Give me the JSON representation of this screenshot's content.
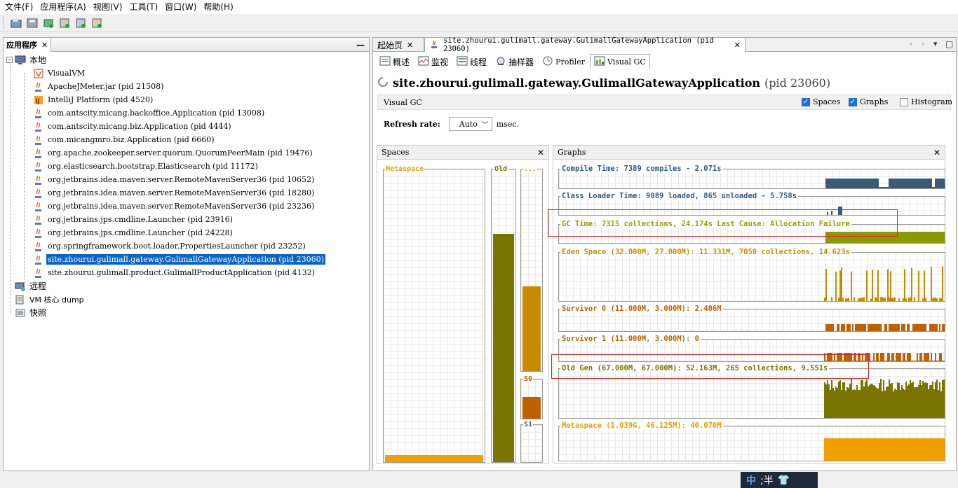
{
  "menu": [
    "文件(F)",
    "应用程序(A)",
    "视图(V)",
    "工具(T)",
    "窗口(W)",
    "帮助(H)"
  ],
  "toolbar": {
    "icons": [
      "open-icon",
      "save-icon",
      "add-jmx-icon",
      "add-core-dump-icon",
      "add-snapshot-icon",
      "add-heap-icon"
    ]
  },
  "left_panel": {
    "tab_label": "应用程序",
    "local": "本地",
    "items": [
      "VisualVM",
      "ApacheJMeter.jar (pid 21508)",
      "IntelliJ Platform (pid 4520)",
      "com.antscity.micang.backoffice.Application (pid 13008)",
      "com.antscity.micang.biz.Application (pid 4444)",
      "com.micangmro.biz.Application (pid 6660)",
      "org.apache.zookeeper.server.quorum.QuorumPeerMain (pid 19476)",
      "org.elasticsearch.bootstrap.Elasticsearch (pid 11172)",
      "org.jetbrains.idea.maven.server.RemoteMavenServer36 (pid 10652)",
      "org.jetbrains.idea.maven.server.RemoteMavenServer36 (pid 18280)",
      "org.jetbrains.idea.maven.server.RemoteMavenServer36 (pid 23236)",
      "org.jetbrains.jps.cmdline.Launcher (pid 23916)",
      "org.jetbrains.jps.cmdline.Launcher (pid 24228)",
      "org.springframework.boot.loader.PropertiesLauncher (pid 23252)",
      "site.zhourui.gulimall.gateway.GulimallGatewayApplication (pid 23060)",
      "site.zhourui.gulimall.product.GulimallProductApplication (pid 4132)"
    ],
    "selected_index": 14,
    "remote": "远程",
    "core_dump": "VM 核心 dump",
    "snapshot": "快照"
  },
  "doc_tabs": {
    "start": "起始页",
    "app": "site.zhourui.gulimall.gateway.GulimallGatewayApplication (pid 23060)"
  },
  "sub_tabs": [
    "概述",
    "监视",
    "线程",
    "抽样器",
    "Profiler",
    "Visual GC"
  ],
  "app_title": {
    "name": "site.zhourui.gulimall.gateway.GulimallGatewayApplication",
    "pid": "(pid 23060)"
  },
  "visual_gc": {
    "label": "Visual GC",
    "spaces_label": "Spaces",
    "graphs_label": "Graphs",
    "histogram_label": "Histogram",
    "spaces_checked": true,
    "graphs_checked": true,
    "histogram_checked": false,
    "refresh_label": "Refresh rate:",
    "refresh_value": "Auto",
    "refresh_unit": "msec."
  },
  "spaces_pane": {
    "title": "Spaces",
    "metaspace": "Metaspace",
    "old": "Old",
    "eden": "...",
    "s0": "S0",
    "s1": "S1",
    "metaspace_fill": 0.025,
    "old_fill": 0.78,
    "eden_fill": 0.42,
    "s0_fill": 0.55,
    "s1_fill": 0.0
  },
  "graphs_pane": {
    "title": "Graphs",
    "compile": "Compile Time: 7389 compiles - 2.071s",
    "class_loader": "Class Loader Time: 9089 loaded, 865 unloaded - 5.758s",
    "gc_time": "GC Time: 7315 collections, 24.174s  Last Cause: Allocation Failure",
    "eden": "Eden Space (32.000M, 27.000M): 11.331M, 7050 collections, 14.623s",
    "survivor0": "Survivor 0 (11.000M, 3.000M): 2.406M",
    "survivor1": "Survivor 1 (11.000M, 3.000M): 0",
    "old_gen": "Old Gen (67.000M, 67.000M): 52.163M, 265 collections, 9.551s",
    "metaspace": "Metaspace (1.039G, 46.125M): 40.070M"
  },
  "colors": {
    "compile": "#3a5a78",
    "gc": "#8a9a00",
    "eden": "#c88a00",
    "survivor": "#c06000",
    "old": "#7a7400",
    "meta": "#f0a000",
    "title_blue": "#2a5a8a"
  },
  "ime": {
    "label": "中",
    "mode": ";半"
  }
}
